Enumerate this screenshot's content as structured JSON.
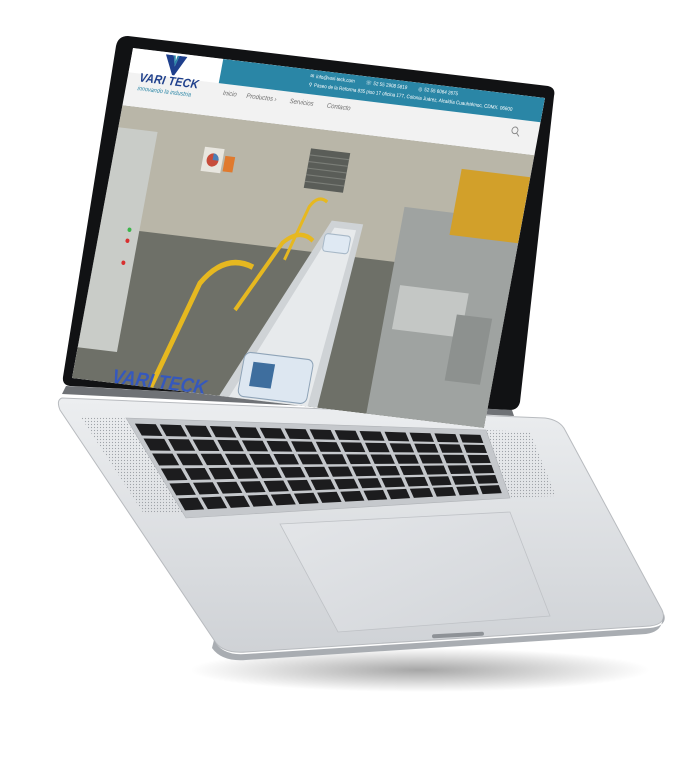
{
  "site": {
    "brand": "VARI TECK",
    "tagline": "innovando la industria",
    "contact": {
      "email": "info@vari-teck.com",
      "phone1": "52 55 2908 5819",
      "phone2": "52 55 6064 2675",
      "address": "Paseo de la Reforma 835 piso 17 oficina 177, Colonia Juárez, Alcaldía Cuauhtémoc, CDMX. 06600"
    },
    "nav": [
      {
        "label": "Inicio"
      },
      {
        "label": "Productos ›"
      },
      {
        "label": "Servicios"
      },
      {
        "label": "Contacto"
      }
    ],
    "hero_watermark": "VARI TECK"
  },
  "colors": {
    "accent": "#2a86a6",
    "brand": "#1e3f8c",
    "yellow_rail": "#e6b820",
    "laptop_silver": "#d9dbde",
    "keys": "#1c1c1e"
  },
  "icons": [
    "email-icon",
    "phone-icon",
    "whatsapp-icon",
    "location-icon",
    "search-icon"
  ]
}
